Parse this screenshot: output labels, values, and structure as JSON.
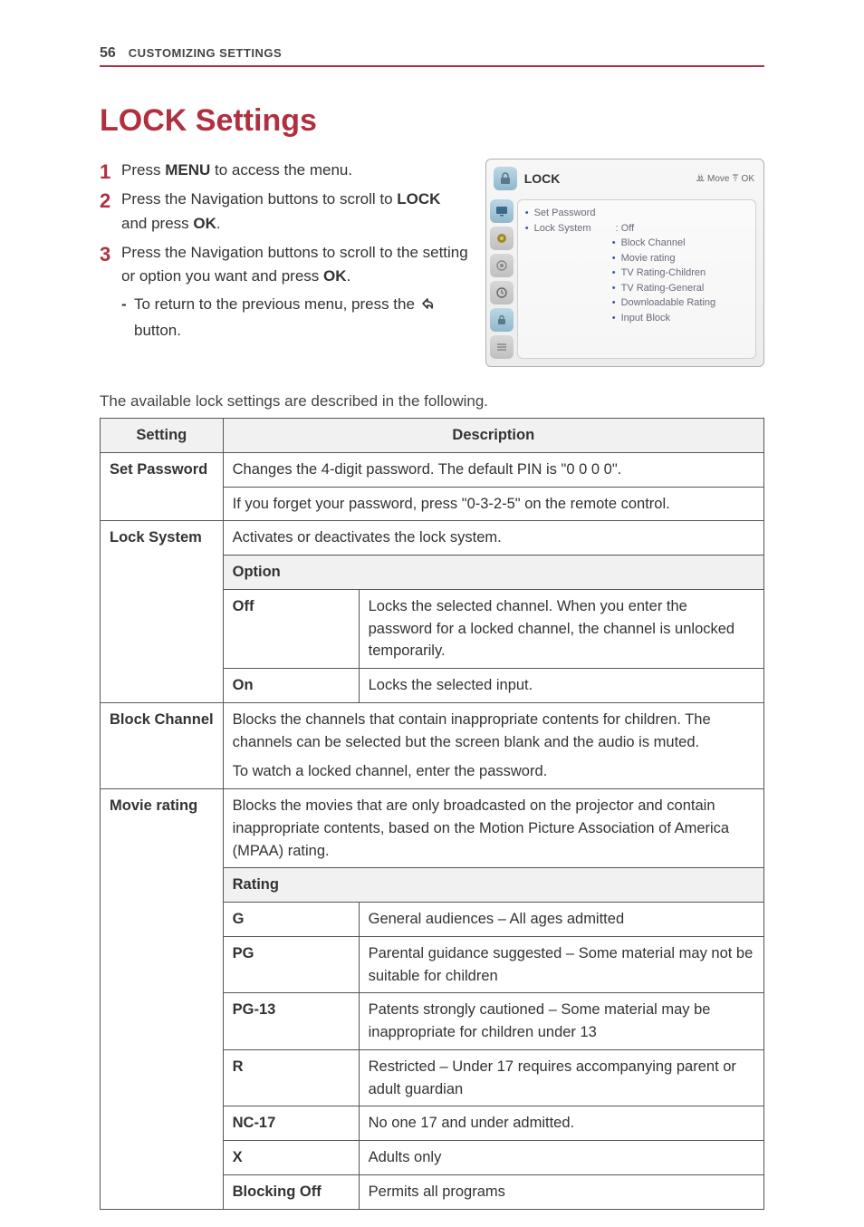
{
  "page_number": "56",
  "section_name": "CUSTOMIZING SETTINGS",
  "title": "LOCK Settings",
  "steps": [
    {
      "prefix": "Press ",
      "bold1": "MENU",
      "rest": " to access the menu."
    },
    {
      "prefix": "Press the Navigation buttons to scroll to ",
      "bold1": "LOCK",
      "rest": " and press ",
      "bold2": "OK",
      "tail": "."
    },
    {
      "prefix": "Press the Navigation buttons to scroll to the setting or option you want and press ",
      "bold1": "OK",
      "rest": "."
    }
  ],
  "sub_bullet": {
    "prefix": "To return to the previous menu, press the ",
    "suffix": " button."
  },
  "osd": {
    "title": "LOCK",
    "help": "ꔣ Move ꔉ OK",
    "items": [
      {
        "label": "Set Password",
        "value": ""
      },
      {
        "label": "Lock System",
        "value": ": Off"
      }
    ],
    "subitems": [
      "Block Channel",
      "Movie rating",
      "TV Rating-Children",
      "TV Rating-General",
      "Downloadable Rating",
      "Input Block"
    ]
  },
  "intro": "The available lock settings are described in the following.",
  "table": {
    "head": {
      "col1": "Setting",
      "col2": "Description"
    },
    "set_password": {
      "label": "Set Password",
      "line1": "Changes the 4-digit password. The default PIN is \"0 0 0 0\".",
      "line2": "If you forget your password, press \"0-3-2-5\" on the remote control."
    },
    "lock_system": {
      "label": "Lock System",
      "desc": "Activates or deactivates the lock system.",
      "option_head": "Option",
      "off_label": "Off",
      "off_desc": "Locks the selected channel. When you enter the password for a locked channel, the channel is unlocked temporarily.",
      "on_label": "On",
      "on_desc": "Locks the selected input."
    },
    "block_channel": {
      "label": "Block Channel",
      "desc1": "Blocks the channels that contain inappropriate contents for children. The channels can be selected but the screen blank and the audio is muted.",
      "desc2": "To watch a locked channel, enter the password."
    },
    "movie_rating": {
      "label": "Movie rating",
      "desc": "Blocks the movies that are only broadcasted on the projector and contain inappropriate contents, based on the Motion Picture Association of America (MPAA) rating.",
      "rating_head": "Rating",
      "rows": [
        {
          "k": "G",
          "v": "General audiences – All ages admitted"
        },
        {
          "k": "PG",
          "v": "Parental guidance suggested – Some material may not be suitable for children"
        },
        {
          "k": "PG-13",
          "v": "Patents strongly cautioned – Some material may be inappropriate for children under 13"
        },
        {
          "k": "R",
          "v": "Restricted – Under 17 requires accompanying parent or adult guardian"
        },
        {
          "k": "NC-17",
          "v": "No one 17 and under admitted."
        },
        {
          "k": "X",
          "v": "Adults only"
        },
        {
          "k": "Blocking Off",
          "v": "Permits all programs"
        }
      ]
    }
  }
}
